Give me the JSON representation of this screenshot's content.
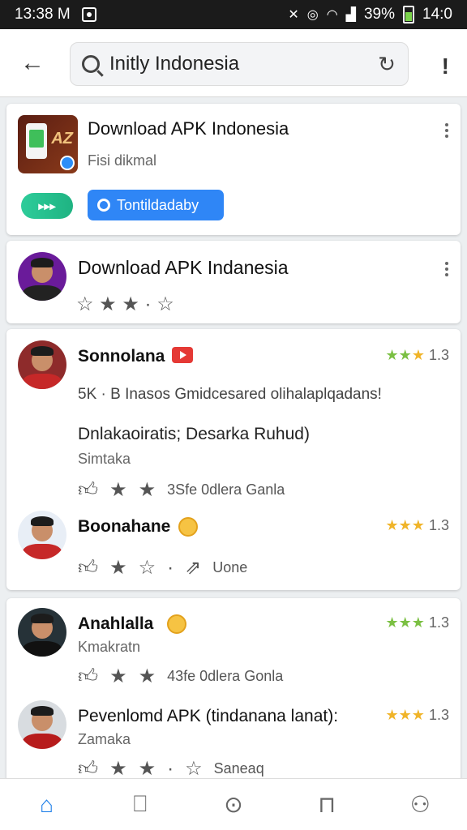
{
  "status_bar": {
    "time": "13:38 M",
    "battery": "39%",
    "clock_right": "14:0"
  },
  "search": {
    "text": "Initly Indonesia"
  },
  "card1": {
    "title": "Download APK Indonesia",
    "subtitle": "Fisi dikmal",
    "button_green": "▸▸▸",
    "button_blue": "Tontildadaby"
  },
  "card2": {
    "title": "Download APK Indanesia",
    "stars": "☆ ★ ★ · ☆"
  },
  "card3": {
    "name": "Sonnolana",
    "rating": "1.3",
    "info": "5K · B  Inasos Gmidcesared olihalaplqadans!",
    "body": "Dnlakaoiratis; Desarka Ruhud)",
    "sub": "Simtaka",
    "actions_text": "3Sfe 0dlera Ganla"
  },
  "card4": {
    "name": "Boonahane",
    "rating": "1.3",
    "actions_text": "Uone"
  },
  "card5": {
    "name": "Anahlalla",
    "rating": "1.3",
    "sub": "Kmakratn",
    "actions_text": "43fe 0dlera Gonla"
  },
  "card6": {
    "name": "Pevenlomd APK (tindanana lanat):",
    "rating": "1.3",
    "sub": "Zamaka",
    "actions_text": "Saneaq"
  },
  "icons": [
    "back-arrow-icon",
    "search-icon",
    "refresh-icon",
    "more-icon",
    "home-icon",
    "bookmark-icon",
    "compass-icon",
    "inbox-icon",
    "profile-icon"
  ],
  "colors": {
    "accent": "#1e7fe8",
    "green": "#2ecc9a",
    "button_blue": "#2f86f6",
    "youtube_red": "#e53935"
  }
}
